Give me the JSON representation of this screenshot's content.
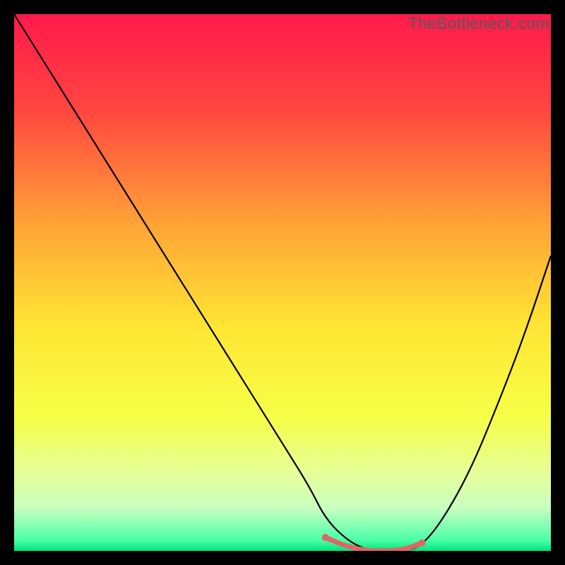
{
  "watermark": "TheBottleneck.com",
  "chart_data": {
    "type": "line",
    "title": "",
    "xlabel": "",
    "ylabel": "",
    "xlim": [
      0,
      100
    ],
    "ylim": [
      0,
      100
    ],
    "gradient_stops": [
      {
        "offset": 0,
        "color": "#ff1a4b"
      },
      {
        "offset": 0.18,
        "color": "#ff4640"
      },
      {
        "offset": 0.4,
        "color": "#ffa636"
      },
      {
        "offset": 0.58,
        "color": "#ffe534"
      },
      {
        "offset": 0.75,
        "color": "#f6ff47"
      },
      {
        "offset": 0.85,
        "color": "#e7ff95"
      },
      {
        "offset": 0.92,
        "color": "#c9ffc0"
      },
      {
        "offset": 0.98,
        "color": "#4cffa8"
      },
      {
        "offset": 1.0,
        "color": "#00e37a"
      }
    ],
    "series": [
      {
        "name": "bottleneck-curve",
        "stroke": "#000000",
        "x": [
          0,
          5,
          10,
          15,
          20,
          25,
          30,
          35,
          40,
          45,
          50,
          55,
          58,
          62,
          66,
          70,
          73,
          76,
          80,
          85,
          90,
          95,
          100
        ],
        "y": [
          100,
          92,
          84,
          76,
          68,
          60,
          52,
          44,
          36,
          28,
          20,
          12,
          6,
          2,
          0,
          0,
          0,
          1,
          6,
          15,
          27,
          40,
          55
        ]
      },
      {
        "name": "fit-band",
        "stroke": "#e06666",
        "x": [
          58,
          62,
          66,
          70,
          73,
          76
        ],
        "y": [
          2.5,
          0.8,
          0,
          0,
          0.3,
          1.5
        ]
      }
    ],
    "fit_endpoints": [
      {
        "x": 58,
        "y": 2.5
      },
      {
        "x": 76,
        "y": 1.5
      }
    ]
  }
}
